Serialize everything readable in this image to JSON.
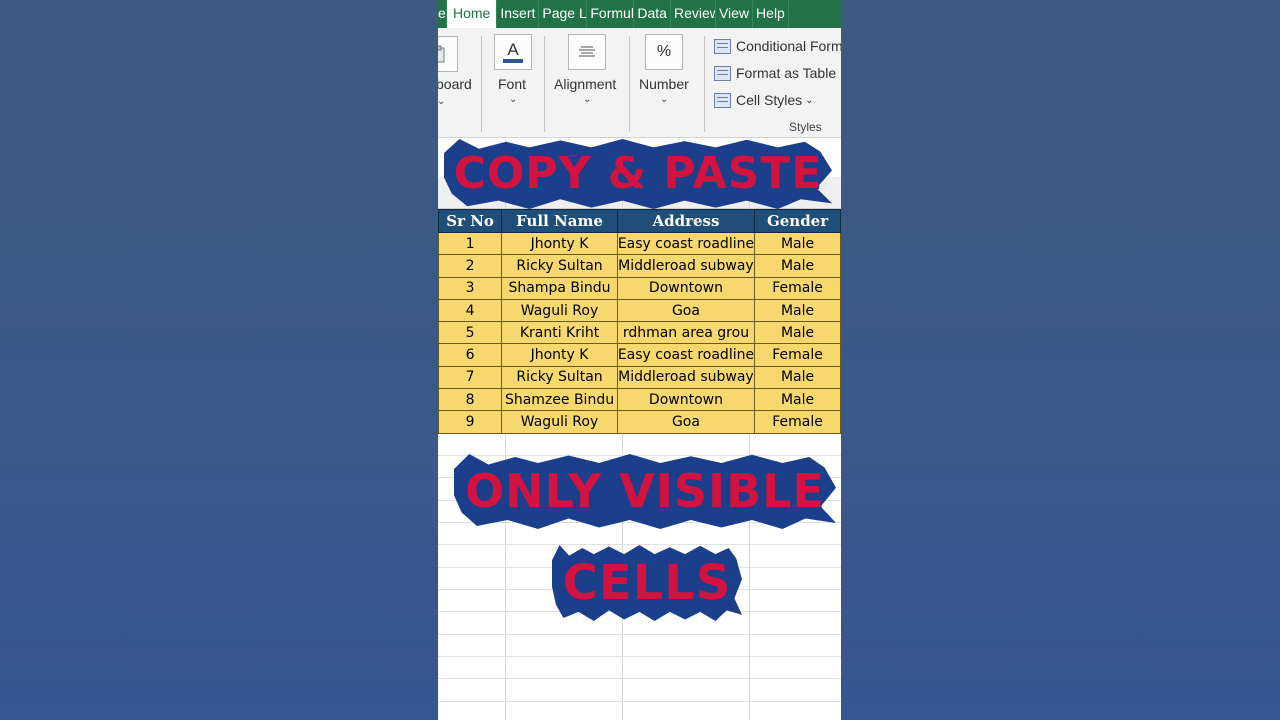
{
  "ribbon": {
    "tabs": [
      "e",
      "Home",
      "Insert",
      "Page La",
      "Formul",
      "Data",
      "Review",
      "View",
      "Help"
    ],
    "active_tab": "Home",
    "clipboard_label": "board",
    "font_label": "Font",
    "alignment_label": "Alignment",
    "number_label": "Number",
    "number_icon": "%",
    "font_icon": "A",
    "styles": {
      "conditional": "Conditional Form",
      "format_table": "Format as Table",
      "cell_styles": "Cell Styles",
      "caption": "Styles"
    }
  },
  "table": {
    "headers": [
      "Sr No",
      "Full Name",
      "Address",
      "Gender"
    ],
    "rows": [
      [
        "1",
        "Jhonty K",
        "Easy coast roadline",
        "Male"
      ],
      [
        "2",
        "Ricky Sultan",
        "Middleroad subway",
        "Male"
      ],
      [
        "3",
        "Shampa Bindu",
        "Downtown",
        "Female"
      ],
      [
        "4",
        "Waguli Roy",
        "Goa",
        "Male"
      ],
      [
        "5",
        "Kranti Kriht",
        "rdhman area grou",
        "Male"
      ],
      [
        "6",
        "Jhonty K",
        "Easy coast roadline",
        "Female"
      ],
      [
        "7",
        "Ricky Sultan",
        "Middleroad subway",
        "Male"
      ],
      [
        "8",
        "Shamzee Bindu",
        "Downtown",
        "Male"
      ],
      [
        "9",
        "Waguli Roy",
        "Goa",
        "Female"
      ]
    ]
  },
  "overlay": {
    "title_top": "COPY & PASTE",
    "title_mid": "ONLY VISIBLE",
    "title_bottom": "CELLS"
  },
  "colors": {
    "excel_green": "#217346",
    "header_blue": "#1f4e79",
    "row_yellow": "#f6d86e",
    "overlay_red": "#d3123f",
    "overlay_outline": "#1b3f8b"
  }
}
